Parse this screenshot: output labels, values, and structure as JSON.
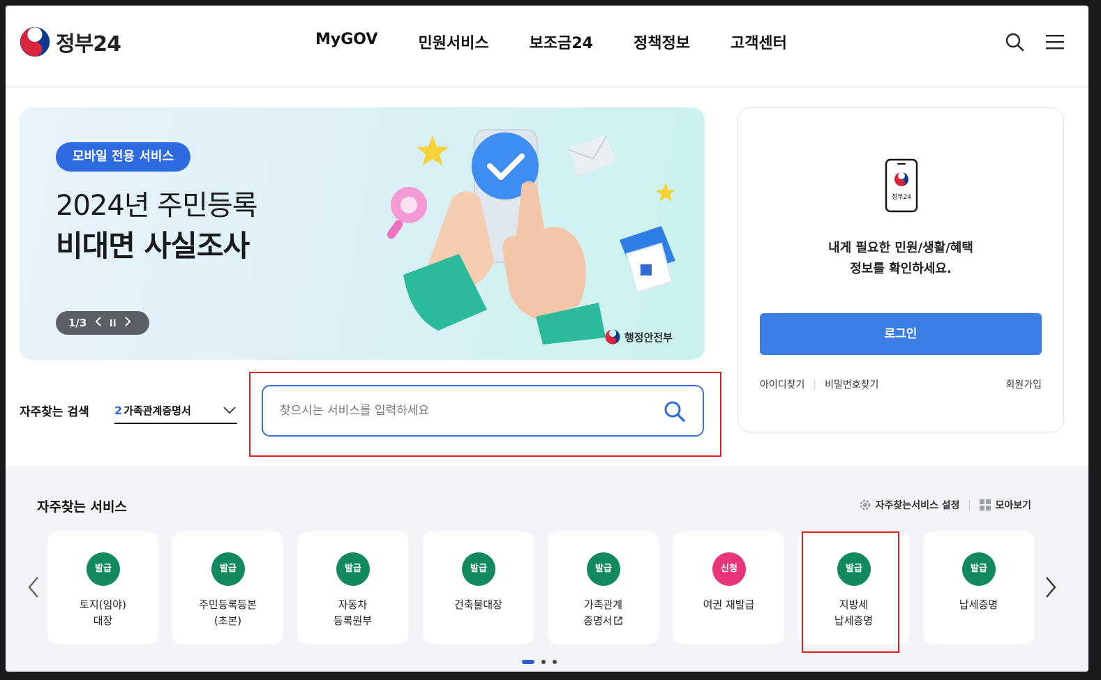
{
  "header": {
    "logo_text": "정부24",
    "nav": [
      "MyGOV",
      "민원서비스",
      "보조금24",
      "정책정보",
      "고객센터"
    ],
    "icons": [
      "search-icon",
      "menu-icon"
    ]
  },
  "banner": {
    "badge": "모바일 전용 서비스",
    "line1": "2024년 주민등록",
    "line2": "비대면 사실조사",
    "pager": "1/3",
    "ministry": "행정안전부"
  },
  "login": {
    "phone_label": "정부24",
    "message_line1": "내게 필요한 민원/생활/혜택",
    "message_line2": "정보를 확인하세요.",
    "button": "로그인",
    "find_id": "아이디찾기",
    "find_pw": "비밀번호찾기",
    "signup": "회원가입"
  },
  "frequent_search": {
    "label": "자주찾는 검색",
    "selected_num": "2",
    "selected_text": "가족관계증명서"
  },
  "search": {
    "placeholder": "찾으시는 서비스를 입력하세요"
  },
  "services": {
    "title": "자주찾는 서비스",
    "settings": "자주찾는서비스 설정",
    "view_all": "모아보기",
    "cards": [
      {
        "badge": "발급",
        "label": "토지(임야)\n대장",
        "color": "green"
      },
      {
        "badge": "발급",
        "label": "주민등록등본\n(초본)",
        "color": "green"
      },
      {
        "badge": "발급",
        "label": "자동차\n등록원부",
        "color": "green"
      },
      {
        "badge": "발급",
        "label": "건축물대장",
        "color": "green"
      },
      {
        "badge": "발급",
        "label": "가족관계\n증명서",
        "color": "green",
        "external": true
      },
      {
        "badge": "신청",
        "label": "여권 재발급",
        "color": "pink"
      },
      {
        "badge": "발급",
        "label": "지방세\n납세증명",
        "color": "green"
      },
      {
        "badge": "발급",
        "label": "납세증명",
        "color": "green"
      }
    ]
  },
  "colors": {
    "primary": "#3b7ee6",
    "green_badge": "#138a5d",
    "pink_badge": "#e8357b",
    "highlight": "#e02020"
  }
}
